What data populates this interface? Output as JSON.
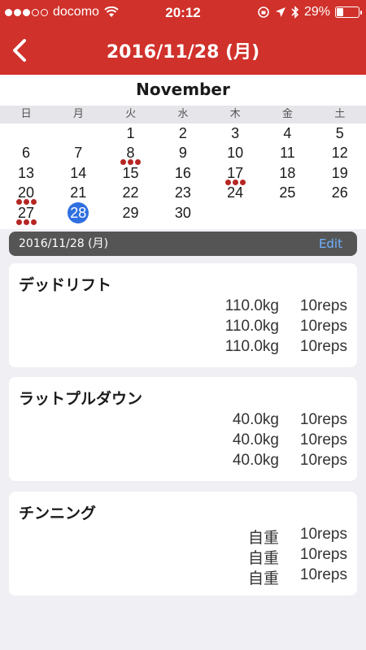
{
  "status": {
    "carrier": "docomo",
    "time": "20:12",
    "battery": "29%",
    "battery_fraction": 0.29
  },
  "nav": {
    "title": "2016/11/28 (月)",
    "back_icon": "chevron-left-icon"
  },
  "calendar": {
    "month": "November",
    "weekdays": [
      "日",
      "月",
      "火",
      "水",
      "木",
      "金",
      "土"
    ],
    "weeks": [
      [
        "",
        "",
        "1",
        "2",
        "3",
        "4",
        "5"
      ],
      [
        "6",
        "7",
        "8",
        "9",
        "10",
        "11",
        "12"
      ],
      [
        "13",
        "14",
        "15",
        "16",
        "17",
        "18",
        "19"
      ],
      [
        "20",
        "21",
        "22",
        "23",
        "24",
        "25",
        "26"
      ],
      [
        "27",
        "28",
        "29",
        "30",
        "",
        "",
        ""
      ]
    ],
    "marked_days": [
      "8",
      "17",
      "20",
      "27"
    ],
    "selected_day": "28",
    "mark_color": "#b52623",
    "selected_color": "#2f6fe0"
  },
  "section": {
    "date": "2016/11/28 (月)",
    "edit_label": "Edit"
  },
  "exercises": [
    {
      "name": "デッドリフト",
      "sets": [
        {
          "weight": "110.0kg",
          "reps": "10reps"
        },
        {
          "weight": "110.0kg",
          "reps": "10reps"
        },
        {
          "weight": "110.0kg",
          "reps": "10reps"
        }
      ]
    },
    {
      "name": "ラットプルダウン",
      "sets": [
        {
          "weight": "40.0kg",
          "reps": "10reps"
        },
        {
          "weight": "40.0kg",
          "reps": "10reps"
        },
        {
          "weight": "40.0kg",
          "reps": "10reps"
        }
      ]
    },
    {
      "name": "チンニング",
      "sets": [
        {
          "weight": "自重",
          "reps": "10reps"
        },
        {
          "weight": "自重",
          "reps": "10reps"
        },
        {
          "weight": "自重",
          "reps": "10reps"
        }
      ]
    }
  ],
  "colors": {
    "accent": "#d0312b",
    "edit": "#6fb1ff"
  }
}
